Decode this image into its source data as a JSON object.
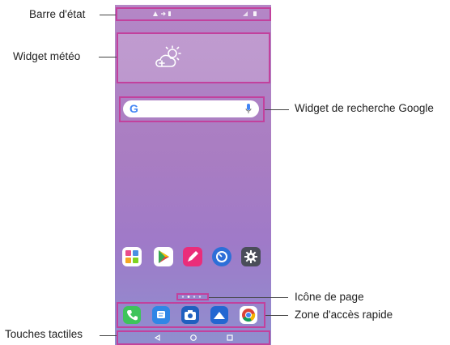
{
  "callouts": {
    "status_bar": "Barre d'état",
    "weather_widget": "Widget météo",
    "google_search_widget": "Widget de recherche Google",
    "page_icon": "Icône de page",
    "quick_access": "Zone d'accès rapide",
    "touch_keys": "Touches tactiles"
  },
  "colors": {
    "highlight": "#c2419d",
    "phone_top": "#b487c6",
    "phone_bottom": "#8f8fcf"
  },
  "icons": {
    "weather": "cloud-sun-icon",
    "search_logo": "google-g-icon",
    "mic": "microphone-icon",
    "home_apps": [
      "app-folder-icon",
      "play-store-icon",
      "pencil-icon",
      "clock-icon",
      "settings-gear-icon"
    ],
    "dock_apps": [
      "phone-icon",
      "messages-icon",
      "camera-icon",
      "gallery-icon",
      "chrome-icon"
    ],
    "nav_keys": [
      "back-triangle-icon",
      "home-circle-icon",
      "recents-square-icon"
    ]
  },
  "search": {
    "logo_text": "G"
  }
}
